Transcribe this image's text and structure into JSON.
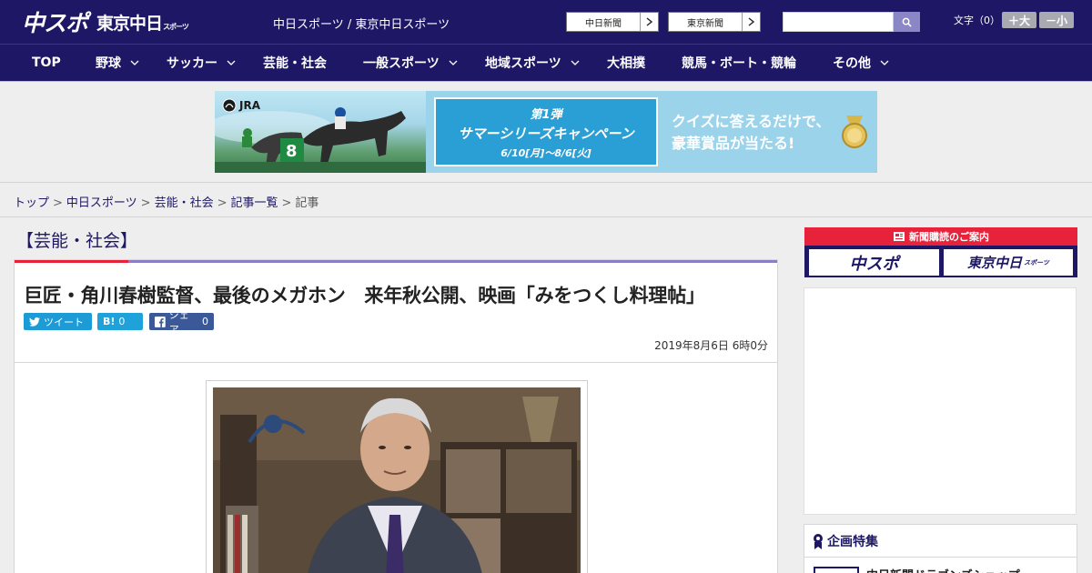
{
  "header": {
    "logo_main": "中スポ",
    "logo_tokyo": "東京中日",
    "logo_tokyo_small": "スポーツ",
    "site_title": "中日スポーツ / 東京中日スポーツ",
    "paper_links": [
      "中日新聞",
      "東京新聞"
    ],
    "search": {
      "placeholder": "",
      "icon": "search-icon"
    },
    "font_size": {
      "label": "文字（0）",
      "larger": "＋大",
      "smaller": "－小"
    }
  },
  "nav": {
    "items": [
      {
        "label": "TOP",
        "dropdown": false
      },
      {
        "label": "野球",
        "dropdown": true
      },
      {
        "label": "サッカー",
        "dropdown": true
      },
      {
        "label": "芸能・社会",
        "dropdown": false
      },
      {
        "label": "一般スポーツ",
        "dropdown": true
      },
      {
        "label": "地域スポーツ",
        "dropdown": true
      },
      {
        "label": "大相撲",
        "dropdown": false
      },
      {
        "label": "競馬・ボート・競輪",
        "dropdown": false
      },
      {
        "label": "その他",
        "dropdown": true
      }
    ]
  },
  "banner": {
    "brand": "JRA",
    "campaign_line1": "第1弾",
    "campaign_line2": "サマーシリーズキャンペーン",
    "campaign_dates": "6/10[月]～8/6[火]",
    "quiz_line1": "クイズに答えるだけで、",
    "quiz_line2": "豪華賞品が当たる!",
    "horse_number": "8"
  },
  "breadcrumb": {
    "items": [
      "トップ",
      "中日スポーツ",
      "芸能・社会",
      "記事一覧"
    ],
    "current": "記事",
    "separator": ">"
  },
  "article": {
    "section": "【芸能・社会】",
    "headline": "巨匠・角川春樹監督、最後のメガホン　来年秋公開、映画「みをつくし料理帖」",
    "share": {
      "twitter_label": "ツイート",
      "hatena_label": "B!",
      "hatena_count": "0",
      "facebook_label": "シェア",
      "facebook_count": "0"
    },
    "date": "2019年8月6日 6時0分"
  },
  "sidebar": {
    "subscribe_title": "新聞購読のご案内",
    "subscribe_chuspo": "中スポ",
    "subscribe_tokyo": "東京中日",
    "subscribe_tokyo_small": "スポーツ",
    "feature_title": "企画特集",
    "feature_item": "中日新聞ドラゴンズショップ"
  },
  "colors": {
    "brand_navy": "#1d1765",
    "accent_red": "#e6233b",
    "accent_purple": "#8a7fc4",
    "twitter_blue": "#1c9bd6",
    "facebook_blue": "#3b5998"
  }
}
